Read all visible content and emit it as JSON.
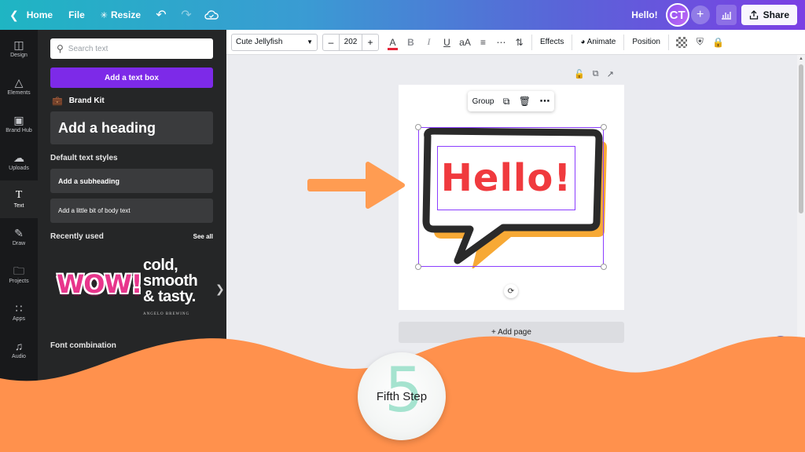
{
  "topbar": {
    "home": "Home",
    "file": "File",
    "resize": "Resize",
    "greeting": "Hello!",
    "avatar_initials": "CT",
    "share": "Share"
  },
  "rail": {
    "items": [
      {
        "label": "Design",
        "icon": "design-icon"
      },
      {
        "label": "Elements",
        "icon": "elements-icon"
      },
      {
        "label": "Brand Hub",
        "icon": "brand-hub-icon"
      },
      {
        "label": "Uploads",
        "icon": "uploads-icon"
      },
      {
        "label": "Text",
        "icon": "text-icon"
      },
      {
        "label": "Draw",
        "icon": "draw-icon"
      },
      {
        "label": "Projects",
        "icon": "folder-icon"
      },
      {
        "label": "Apps",
        "icon": "apps-grid-icon"
      },
      {
        "label": "Audio",
        "icon": "music-note-icon"
      }
    ],
    "active": "Text"
  },
  "panel": {
    "search_placeholder": "Search text",
    "add_text_box": "Add a text box",
    "brand_kit": "Brand Kit",
    "heading": "Add a heading",
    "default_styles": "Default text styles",
    "subheading": "Add a subheading",
    "body": "Add a little bit of body text",
    "recently_used": "Recently used",
    "see_all": "See all",
    "recent_wow": "WOW!",
    "recent_cold_lines": [
      "cold,",
      "smooth",
      "& tasty."
    ],
    "recent_cold_brand": "ANGELO BREWING",
    "font_combinations": "Font combination"
  },
  "format": {
    "font": "Cute Jellyfish",
    "size": "202",
    "effects": "Effects",
    "animate": "Animate",
    "position": "Position",
    "text_color": "#e5253a"
  },
  "canvas": {
    "group": "Group",
    "text": "Hello!",
    "add_page": "+ Add page",
    "hello_color": "#f03a3e",
    "selection_color": "#8b3dff"
  },
  "badge": {
    "number": "5",
    "label": "Fifth Step",
    "number_color": "#a5e3cf"
  },
  "colors": {
    "accent_purple": "#7d2ae8",
    "wave_orange": "#ff914d",
    "arrow_orange": "#ff9c52"
  }
}
